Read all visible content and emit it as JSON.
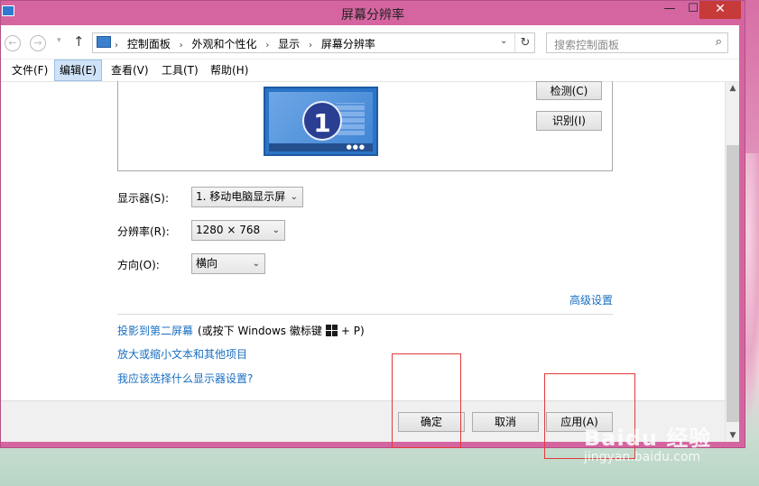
{
  "window": {
    "title": "屏幕分辨率",
    "min_label": "—",
    "max_label": "☐",
    "close_label": "✕"
  },
  "nav": {
    "back_label": "←",
    "forward_label": "→",
    "recent_label": "▾",
    "up_label": "↑"
  },
  "address": {
    "crumbs": [
      "控制面板",
      "外观和个性化",
      "显示",
      "屏幕分辨率"
    ],
    "separator": "›",
    "dropdown_label": "⌄",
    "refresh_label": "↻"
  },
  "search": {
    "placeholder": "搜索控制面板",
    "icon_label": "⌕"
  },
  "menu": {
    "items": [
      "文件(F)",
      "编辑(E)",
      "查看(V)",
      "工具(T)",
      "帮助(H)"
    ],
    "active_index": 1
  },
  "preview": {
    "monitor_number": "1",
    "detect_label": "检测(C)",
    "identify_label": "识别(I)"
  },
  "settings": {
    "display_label": "显示器(S):",
    "display_value": "1. 移动电脑显示屏",
    "resolution_label": "分辨率(R):",
    "resolution_value": "1280 × 768",
    "orientation_label": "方向(O):",
    "orientation_value": "横向",
    "caret": "⌄"
  },
  "links": {
    "advanced": "高级设置",
    "project": "投影到第二屏幕",
    "project_suffix_before": " (或按下 Windows 徽标键",
    "project_suffix_after": "+ P)",
    "zoom": "放大或缩小文本和其他项目",
    "which": "我应该选择什么显示器设置?"
  },
  "footer": {
    "ok_label": "确定",
    "cancel_label": "取消",
    "apply_label": "应用(A)"
  },
  "scrollbar": {
    "up_label": "▲",
    "down_label": "▼"
  },
  "watermark": {
    "brand": "Baidu 经验",
    "url": "jingyan.baidu.com"
  },
  "colors": {
    "window_frame": "#d565a0",
    "link": "#1a6fc2",
    "annotation": "#e23a3a",
    "close_button": "#c73a3a"
  }
}
